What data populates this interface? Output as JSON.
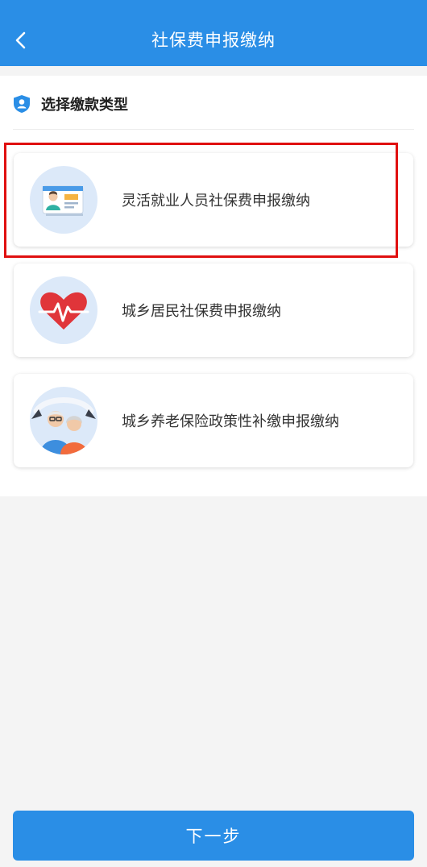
{
  "header": {
    "title": "社保费申报缴纳",
    "back_icon": "chevron-left-icon"
  },
  "section": {
    "title": "选择缴款类型",
    "icon": "shield-user-icon"
  },
  "options": [
    {
      "label": "灵活就业人员社保费申报缴纳",
      "icon": "id-card-icon",
      "selected": true
    },
    {
      "label": "城乡居民社保费申报缴纳",
      "icon": "heartbeat-icon",
      "selected": false
    },
    {
      "label": "城乡养老保险政策性补缴申报缴纳",
      "icon": "elderly-couple-icon",
      "selected": false
    }
  ],
  "footer": {
    "next_label": "下一步"
  },
  "colors": {
    "primary": "#2a8ee6",
    "highlight": "#e01010",
    "background": "#f4f4f4"
  }
}
